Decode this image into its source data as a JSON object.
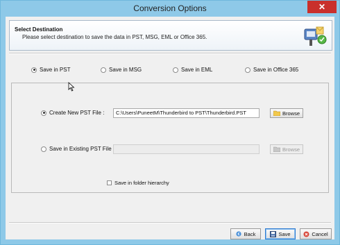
{
  "window": {
    "title": "Conversion Options",
    "close_glyph": "✕"
  },
  "header": {
    "title": "Select Destination",
    "description": "Please select destination to save the data in PST, MSG, EML or Office 365.",
    "icon": "mailbox-icon"
  },
  "destination_options": [
    {
      "label": "Save in PST",
      "selected": true
    },
    {
      "label": "Save in MSG",
      "selected": false
    },
    {
      "label": "Save in EML",
      "selected": false
    },
    {
      "label": "Save in Office 365",
      "selected": false
    }
  ],
  "pst_options": {
    "create_new": {
      "label": "Create New PST File :",
      "selected": true,
      "value": "C:\\Users\\PuneetM\\Thunderbird to PST\\Thunderbird.PST",
      "browse_label": "Browse"
    },
    "existing": {
      "label": "Save in Existing PST File :",
      "selected": false,
      "value": "",
      "browse_label": "Browse"
    },
    "folder_hierarchy": {
      "label": "Save in folder hierarchy",
      "checked": false
    }
  },
  "footer": {
    "back_label": "Back",
    "save_label": "Save",
    "cancel_label": "Cancel"
  },
  "colors": {
    "title_bar": "#8ec9e8",
    "close": "#c9302c",
    "accent": "#2f7bd0"
  }
}
